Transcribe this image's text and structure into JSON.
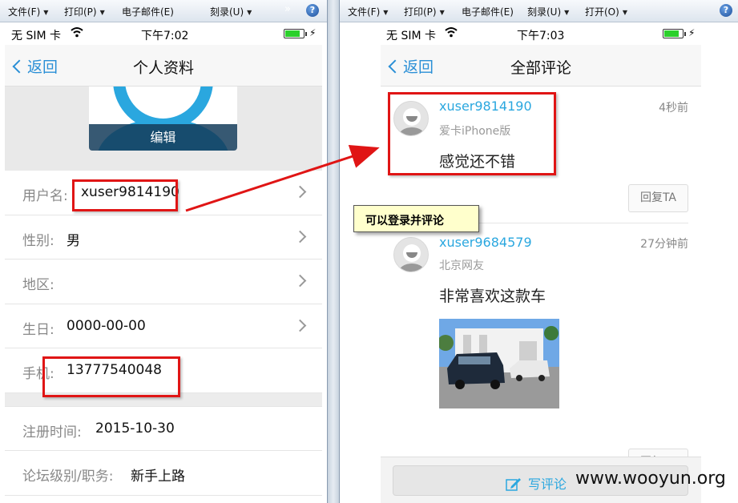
{
  "left_window": {
    "menu": [
      {
        "label": "文件(F)"
      },
      {
        "label": "打印(P)"
      },
      {
        "label": "电子邮件(E)"
      },
      {
        "label": "刻录(U)"
      }
    ],
    "more": "»",
    "help": "?"
  },
  "right_window": {
    "menu": [
      {
        "label": "文件(F)"
      },
      {
        "label": "打印(P)"
      },
      {
        "label": "电子邮件(E)"
      },
      {
        "label": "刻录(U)"
      },
      {
        "label": "打开(O)"
      }
    ],
    "help": "?"
  },
  "profile_screen": {
    "status": {
      "carrier": "无 SIM 卡",
      "time": "下午7:02",
      "charge": "⚡"
    },
    "nav": {
      "back": "返回",
      "title": "个人资料"
    },
    "avatar_edit": "编辑",
    "rows": [
      {
        "label": "用户名:",
        "value": "xuser9814190"
      },
      {
        "label": "性别:",
        "value": "男"
      },
      {
        "label": "地区:",
        "value": ""
      },
      {
        "label": "生日:",
        "value": "0000-00-00"
      },
      {
        "label": "手机:",
        "value": "13777540048"
      }
    ],
    "rows2": [
      {
        "label": "注册时间:",
        "value": "2015-10-30"
      },
      {
        "label": "论坛级别/职务:",
        "value": "新手上路"
      }
    ]
  },
  "comments_screen": {
    "status": {
      "carrier": "无 SIM 卡",
      "time": "下午7:03",
      "charge": "⚡"
    },
    "nav": {
      "back": "返回",
      "title": "全部评论"
    },
    "comments": [
      {
        "user": "xuser9814190",
        "time": "4秒前",
        "source": "爱卡iPhone版",
        "text": "感觉还不错",
        "reply": "回复TA"
      },
      {
        "user": "xuser9684579",
        "time": "27分钟前",
        "source": "北京网友",
        "text": "非常喜欢这款车",
        "reply": "回复TA"
      }
    ],
    "write_comment": "写评论"
  },
  "annotation": {
    "tooltip": "可以登录并评论",
    "color": "#e01515"
  },
  "watermark": "www.wooyun.org"
}
